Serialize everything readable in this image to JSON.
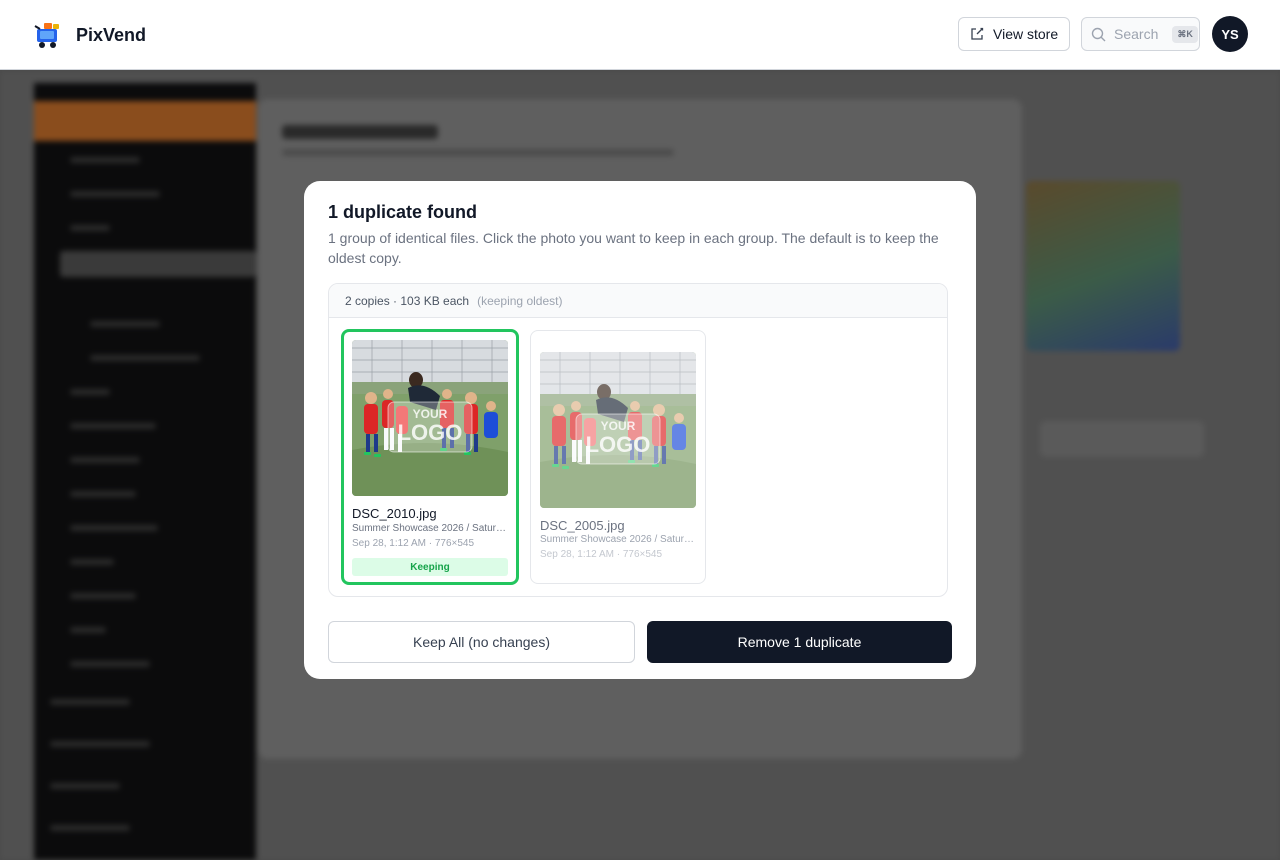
{
  "app": {
    "brand_name": "PixVend",
    "view_store_label": "View store",
    "search_placeholder": "Search",
    "search_shortcut": "⌘K",
    "avatar_initials": "YS"
  },
  "modal": {
    "title": "1 duplicate found",
    "description": "1 group of identical files. Click the photo you want to keep in each group. The default is to keep the oldest copy.",
    "group": {
      "summary": "2 copies · 103 KB each",
      "policy_note": "(keeping oldest)",
      "copies": [
        {
          "filename": "DSC_2010.jpg",
          "path": "Summer Showcase 2026 / Saturday",
          "meta": "Sep 28, 1:12 AM · 776×545",
          "status": "Keeping",
          "watermark_text": [
            "YOUR",
            "LOGO"
          ]
        },
        {
          "filename": "DSC_2005.jpg",
          "path": "Summer Showcase 2026 / Saturday",
          "meta": "Sep 28, 1:12 AM · 776×545",
          "watermark_text": [
            "YOUR",
            "LOGO"
          ]
        }
      ]
    },
    "keep_all_label": "Keep All (no changes)",
    "remove_label": "Remove 1 duplicate"
  },
  "colors": {
    "keep_border": "#22c55e",
    "keep_badge_bg": "#dcfce7",
    "primary_button": "#111827",
    "overlay": "#505050"
  },
  "icons": {
    "view_store": "external-edit-icon",
    "search": "search-icon",
    "brand": "vending-cart-logo"
  }
}
